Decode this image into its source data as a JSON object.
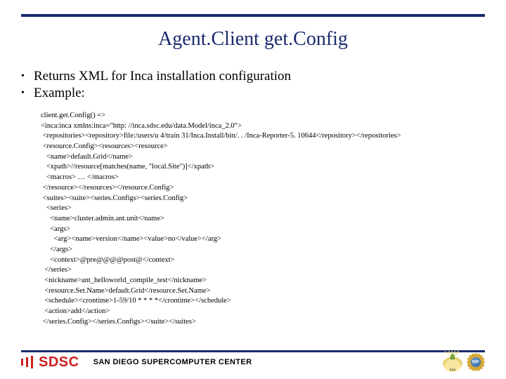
{
  "title": "Agent.Client get.Config",
  "bullets": [
    "Returns XML for Inca installation configuration",
    "Example:"
  ],
  "xml": "client.get.Config() =>\n<inca:inca xmlns:inca=\"http: //inca.sdsc.edu/data.Model/inca_2.0\">\n <repositories><repository>file:/users/u 4/train 31/Inca.Install/bin/. . /Inca-Reporter-5. 10644</repository></repositories>\n <resource.Config><resources><resource>\n   <name>default.Grid</name>\n   <xpath>//resource[matches(name, \"local.Site\")]</xpath>\n   <macros> … </macros>\n </resource></resources></resource.Config>\n <suites><suite><series.Configs><series.Config>\n   <series>\n     <name>cluster.admin.ant.unit</name>\n     <args>\n       <arg><name>version</name><value>no</value></arg>\n     </args>\n     <context>@pre@@@@post@</context>\n  </series>\n  <nickname>ant_helloworld_compile_test</nickname>\n  <resource.Set.Name>default.Grid</resource.Set.Name>\n  <schedule><crontime>1-59/10 * * * *</crontime></schedule>\n  <action>add</action>\n </series.Config></series.Configs></suite></suites>",
  "footer": {
    "sdsc": "SDSC",
    "center": "SAN DIEGO SUPERCOMPUTER CENTER",
    "inca": "inca",
    "nsf": "NSF"
  }
}
